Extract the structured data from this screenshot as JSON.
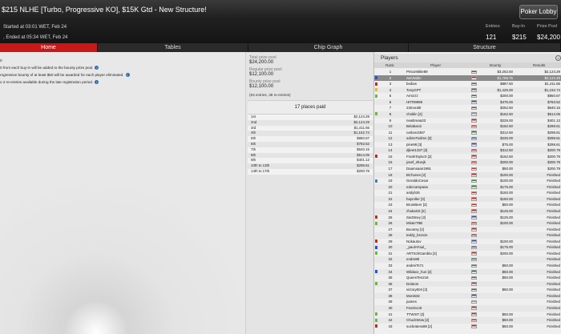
{
  "window": {
    "title": "$215 NLHE [Turbo, Progressive KO], $15K Gtd - New Structure!",
    "lobby_button": "Poker Lobby"
  },
  "info": {
    "started": "Started at 03:01 WET, Feb 24",
    "ended": ", Ended at 05:34 WET, Feb 24",
    "entries_label": "Entries:",
    "entries_value": "121",
    "buyin_label": "Buy-In",
    "buyin_value": "$215",
    "prizepool_label": "Prize Pool",
    "prizepool_value": "$24,200"
  },
  "tabs": [
    "Home",
    "Tables",
    "Chip Graph",
    "Structure"
  ],
  "rules": [
    "0",
    "0 from each buy-in will be added to the bounty prize pool.",
    "rogressive bounty of at least $50 will be awarded for each player eliminated.",
    "o 2 re-entries available during the late registration period."
  ],
  "pool": {
    "total_label": "Total prize pool",
    "total_value": "$24,200.00",
    "regular_label": "Regular prize pool",
    "regular_value": "$12,100.00",
    "bounty_label": "Bounty prize pool",
    "bounty_value": "$12,100.00",
    "entries_note": "(83 entries, 38 re-entries)",
    "places_paid": "17 places paid"
  },
  "prizes": [
    {
      "place": "1st",
      "amount": "$2,124.29"
    },
    {
      "place": "2nd",
      "amount": "$2,124.29"
    },
    {
      "place": "3rd",
      "amount": "$1,411.65"
    },
    {
      "place": "4th",
      "amount": "$1,152.74"
    },
    {
      "place": "5th",
      "amount": "$850.67"
    },
    {
      "place": "6th",
      "amount": "$783.52"
    },
    {
      "place": "7th",
      "amount": "$640.15"
    },
    {
      "place": "8th",
      "amount": "$514.05"
    },
    {
      "place": "9th",
      "amount": "$401.13"
    },
    {
      "place": "10th to 13th",
      "amount": "$298.61"
    },
    {
      "place": "14th to 17th",
      "amount": "$200.79"
    }
  ],
  "players": {
    "title": "Players",
    "columns": {
      "rank": "Rank",
      "player": "Player",
      "bounty": "Bounty",
      "results": "Results"
    },
    "rows": [
      {
        "rank": "1",
        "name": "PrisonMike89",
        "bounty": "$3,262.50",
        "result": "$2,124.29",
        "swatch": "",
        "flag": "#d52b1e"
      },
      {
        "rank": "2",
        "name": "SwVtabin",
        "bounty": "$1,768.75",
        "result": "$2,124.29",
        "swatch": "#2255cc",
        "flag": "#d52b1e",
        "selected": true
      },
      {
        "rank": "3",
        "name": "bedias",
        "bounty": "$887.50",
        "result": "$1,411.65",
        "swatch": "#d42020",
        "flag": "#cc3333"
      },
      {
        "rank": "4",
        "name": "TonyGPT",
        "bounty": "$1,425.00",
        "result": "$1,152.74",
        "swatch": "#e0c020",
        "flag": "#2a8a3a"
      },
      {
        "rank": "5",
        "name": "Armzzz",
        "bounty": "$200.00",
        "result": "$850.67",
        "swatch": "#66bb33",
        "flag": "#2a8a3a"
      },
      {
        "rank": "6",
        "name": "HITR9999",
        "bounty": "$475.00",
        "result": "$783.52",
        "swatch": "",
        "flag": "#3355aa"
      },
      {
        "rank": "7",
        "name": "23moral0",
        "bounty": "$252.50",
        "result": "$640.15",
        "swatch": "",
        "flag": "#d52b1e"
      },
      {
        "rank": "8",
        "name": "choklin [2]",
        "bounty": "$162.50",
        "result": "$514.05",
        "swatch": "#66bb33",
        "flag": "#8899bb"
      },
      {
        "rank": "9",
        "name": "newbreaa33",
        "bounty": "$225.00",
        "result": "$401.13",
        "swatch": "",
        "flag": "#d52b1e"
      },
      {
        "rank": "10",
        "name": "Belabacsi",
        "bounty": "$162.50",
        "result": "$298.61",
        "swatch": "",
        "flag": "#d52b1e"
      },
      {
        "rank": "11",
        "name": "carbon2387",
        "bounty": "$312.50",
        "result": "$298.61",
        "swatch": "",
        "flag": "#2a8a3a"
      },
      {
        "rank": "12",
        "name": "sdimsTodims [3]",
        "bounty": "$225.00",
        "result": "$298.61",
        "swatch": "",
        "flag": "#3355aa"
      },
      {
        "rank": "13",
        "name": "pine98 [3]",
        "bounty": "$75.00",
        "result": "$298.61",
        "swatch": "",
        "flag": "#3355aa"
      },
      {
        "rank": "14",
        "name": "djleet1337 [2]",
        "bounty": "$312.50",
        "result": "$200.79",
        "swatch": "",
        "flag": "#d52b1e"
      },
      {
        "rank": "15",
        "name": "FrankTaylor3 [2]",
        "bounty": "$162.50",
        "result": "$200.79",
        "swatch": "#d42020",
        "flag": "#d52b1e"
      },
      {
        "rank": "16",
        "name": "josef_shvejk",
        "bounty": "$200.00",
        "result": "$200.79",
        "swatch": "",
        "flag": "#d52b1e"
      },
      {
        "rank": "17",
        "name": "Daamsaan1991",
        "bounty": "$50.00",
        "result": "$200.79",
        "swatch": "",
        "flag": "#cc3333"
      },
      {
        "rank": "18",
        "name": "BChones [2]",
        "bounty": "$100.00",
        "result": "Finished",
        "swatch": "",
        "flag": "#d52b1e"
      },
      {
        "rank": "19",
        "name": "GeraldoCesar",
        "bounty": "$100.00",
        "result": "Finished",
        "swatch": "#2a8acc",
        "flag": "#2a8a3a"
      },
      {
        "rank": "20",
        "name": "edercampana",
        "bounty": "$175.00",
        "result": "Finished",
        "swatch": "",
        "flag": "#2a8a3a"
      },
      {
        "rank": "21",
        "name": "andyh26",
        "bounty": "$150.00",
        "result": "Finished",
        "swatch": "",
        "flag": "#d52b1e"
      },
      {
        "rank": "22",
        "name": "hayroller [3]",
        "bounty": "$150.00",
        "result": "Finished",
        "swatch": "",
        "flag": "#d52b1e"
      },
      {
        "rank": "23",
        "name": "BruinBeer [2]",
        "bounty": "$50.00",
        "result": "Finished",
        "swatch": "",
        "flag": "#d52b1e"
      },
      {
        "rank": "24",
        "name": "zhukaSS [2]",
        "bounty": "$125.00",
        "result": "Finished",
        "swatch": "",
        "flag": "#d52b1e"
      },
      {
        "rank": "25",
        "name": "Sw33ney [2]",
        "bounty": "$125.00",
        "result": "Finished",
        "swatch": "#d42020",
        "flag": "#3355aa"
      },
      {
        "rank": "26",
        "name": "MisterT8B",
        "bounty": "$100.00",
        "result": "Finished",
        "swatch": "#66bb33",
        "flag": "#d52b1e"
      },
      {
        "rank": "27",
        "name": "Boootsy [2]",
        "bounty": "",
        "result": "Finished",
        "swatch": "",
        "flag": "#d52b1e"
      },
      {
        "rank": "28",
        "name": "teddy_bronze",
        "bounty": "",
        "result": "Finished",
        "swatch": "",
        "flag": "#d52b1e"
      },
      {
        "rank": "29",
        "name": "Nokautov",
        "bounty": "$100.00",
        "result": "Finished",
        "swatch": "#d42020",
        "flag": "#3355aa"
      },
      {
        "rank": "30",
        "name": "_paulAFaul_",
        "bounty": "$175.00",
        "result": "Finished",
        "swatch": "#2255cc",
        "flag": "#3355aa"
      },
      {
        "rank": "31",
        "name": "ARTSchGambla [3]",
        "bounty": "$200.00",
        "result": "Finished",
        "swatch": "#66bb33",
        "flag": "#cc3333"
      },
      {
        "rank": "32",
        "name": "endre88",
        "bounty": "",
        "result": "Finished",
        "swatch": "",
        "flag": "#2a8a3a"
      },
      {
        "rank": "33",
        "name": "andreiTs71",
        "bounty": "$50.00",
        "result": "Finished",
        "swatch": "",
        "flag": "#cc3333"
      },
      {
        "rank": "34",
        "name": "Wildace_hun [2]",
        "bounty": "$50.00",
        "result": "Finished",
        "swatch": "#2255cc",
        "flag": "#2a8a3a"
      },
      {
        "rank": "35",
        "name": "QueenTen216",
        "bounty": "$50.00",
        "result": "Finished",
        "swatch": "",
        "flag": "#d52b1e"
      },
      {
        "rank": "36",
        "name": "Dolaron",
        "bounty": "",
        "result": "Finished",
        "swatch": "#66bb33",
        "flag": "#cc3333"
      },
      {
        "rank": "37",
        "name": "victory604 [2]",
        "bounty": "$50.00",
        "result": "Finished",
        "swatch": "",
        "flag": "#d52b1e"
      },
      {
        "rank": "38",
        "name": "Moni532",
        "bounty": "",
        "result": "Finished",
        "swatch": "",
        "flag": "#3355aa"
      },
      {
        "rank": "39",
        "name": "juanes",
        "bounty": "",
        "result": "Finished",
        "swatch": "",
        "flag": "#d4a017"
      },
      {
        "rank": "40",
        "name": "FearScott",
        "bounty": "",
        "result": "Finished",
        "swatch": "",
        "flag": "#d52b1e"
      },
      {
        "rank": "41",
        "name": "TTWIST [2]",
        "bounty": "$50.00",
        "result": "Finished",
        "swatch": "#66bb33",
        "flag": "#d52b1e"
      },
      {
        "rank": "42",
        "name": "ChuckWow [2]",
        "bounty": "$50.00",
        "result": "Finished",
        "swatch": "#66bb33",
        "flag": "#d52b1e"
      },
      {
        "rank": "43",
        "name": "suckratess88 [2]",
        "bounty": "$50.00",
        "result": "Finished",
        "swatch": "#d42020",
        "flag": "#d52b1e"
      }
    ]
  }
}
